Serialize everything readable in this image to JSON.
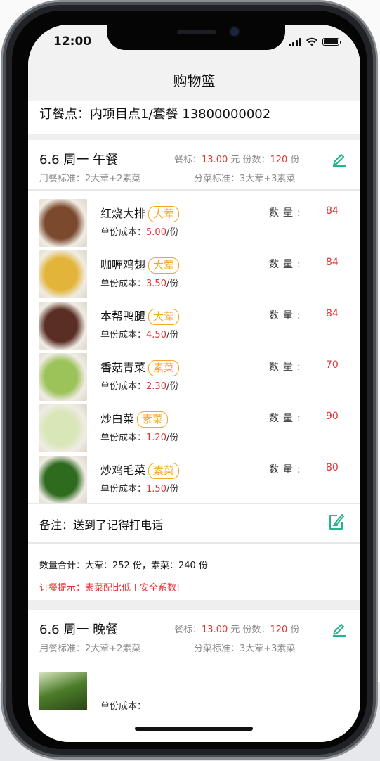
{
  "status": {
    "time": "12:00"
  },
  "nav": {
    "title": "购物篮"
  },
  "order_point": {
    "text": "订餐点：内项目点1/套餐 13800000002"
  },
  "meals": [
    {
      "title": "6.6 周一 午餐",
      "price_label": "餐标：",
      "price_value": "13.00",
      "price_unit": " 元  份数：",
      "count_value": "120",
      "count_unit": " 份",
      "standard": "用餐标准：2大荤+2素菜",
      "split": "分菜标准：3大荤+3素菜"
    },
    {
      "title": "6.6 周一 晚餐",
      "price_label": "餐标：",
      "price_value": "13.00",
      "price_unit": " 元  份数：",
      "count_value": "120",
      "count_unit": " 份",
      "standard": "用餐标准：2大荤+2素菜",
      "split": "分菜标准：3大荤+3素菜"
    }
  ],
  "dishes": [
    {
      "name": "红烧大排",
      "tag": "大荤",
      "cost_label": "单份成本：",
      "cost": "5.00",
      "cost_unit": "/份",
      "qty_label": "数量:",
      "qty": "84",
      "thumb_color": "#7b4a2e"
    },
    {
      "name": "咖喱鸡翅",
      "tag": "大荤",
      "cost_label": "单份成本：",
      "cost": "3.50",
      "cost_unit": "/份",
      "qty_label": "数量:",
      "qty": "84",
      "thumb_color": "#e2b53a"
    },
    {
      "name": "本帮鸭腿",
      "tag": "大荤",
      "cost_label": "单份成本：",
      "cost": "4.50",
      "cost_unit": "/份",
      "qty_label": "数量:",
      "qty": "84",
      "thumb_color": "#5a2e24"
    },
    {
      "name": "香菇青菜",
      "tag": "素菜",
      "cost_label": "单份成本：",
      "cost": "2.30",
      "cost_unit": "/份",
      "qty_label": "数量:",
      "qty": "70",
      "thumb_color": "#9cc25a"
    },
    {
      "name": "炒白菜",
      "tag": "素菜",
      "cost_label": "单份成本：",
      "cost": "1.20",
      "cost_unit": "/份",
      "qty_label": "数量:",
      "qty": "90",
      "thumb_color": "#d8e6b8"
    },
    {
      "name": "炒鸡毛菜",
      "tag": "素菜",
      "cost_label": "单份成本：",
      "cost": "1.50",
      "cost_unit": "/份",
      "qty_label": "数量:",
      "qty": "80",
      "thumb_color": "#2f6b1e"
    }
  ],
  "remark": {
    "text": "备注：送到了记得打电话"
  },
  "summary": {
    "totals": "数量合计：大荤：252 份，素菜：240 份",
    "tip": "订餐提示：素菜配比低于安全系数!"
  },
  "partial_dish": {
    "cost_text": "单份成本："
  }
}
